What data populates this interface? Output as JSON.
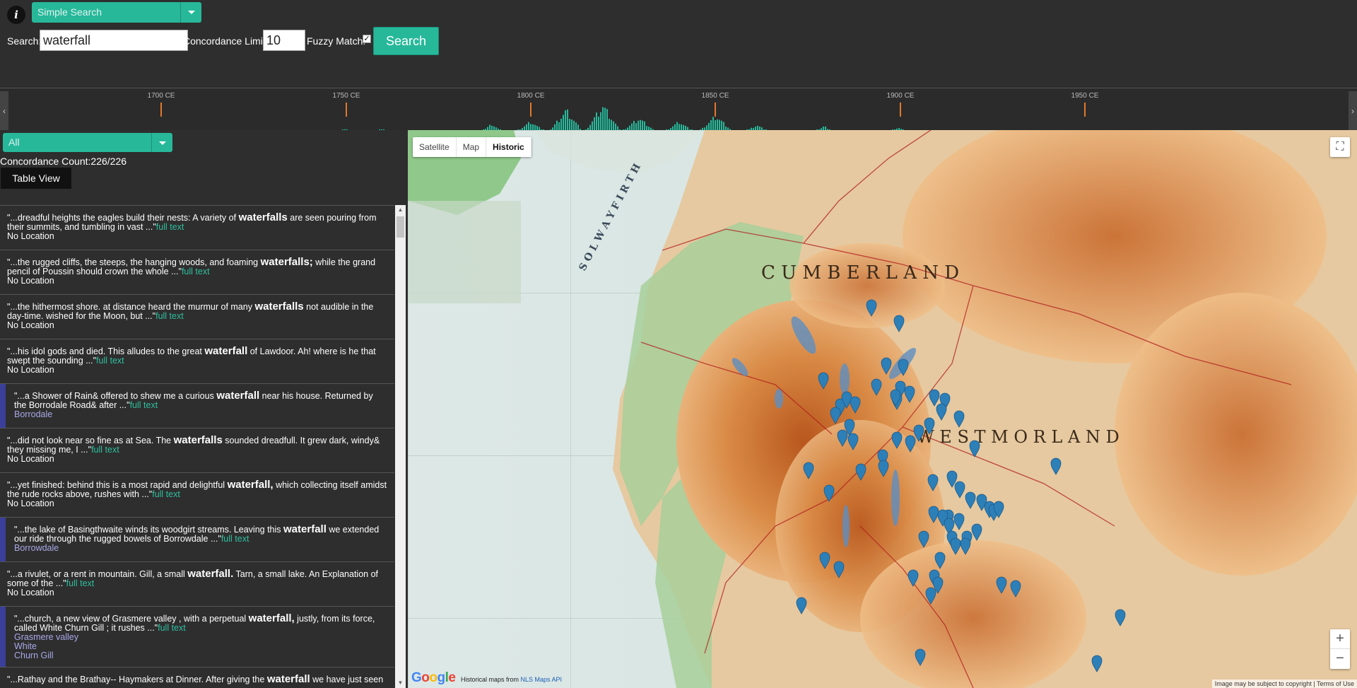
{
  "header": {
    "info_icon_glyph": "i",
    "search_mode": "Simple Search",
    "search_label": "Search:",
    "search_value": "waterfall",
    "limit_label": "Concordance Limit:",
    "limit_value": "10",
    "fuzzy_label": "Fuzzy Match:",
    "fuzzy_checked": true,
    "search_button": "Search"
  },
  "timeline": {
    "ticks": [
      "1700 CE",
      "1750 CE",
      "1800 CE",
      "1850 CE",
      "1900 CE",
      "1950 CE"
    ],
    "left_arrow": "‹",
    "right_arrow": "›",
    "accent_color": "#e07a2c",
    "bar_color": "#27b89a"
  },
  "left_panel": {
    "filter": "All",
    "concordance_count": "Concordance Count:226/226",
    "table_view_button": "Table View",
    "results": [
      {
        "pre": "\"...dreadful heights the eagles build their nests: A variety of ",
        "kw": "waterfalls",
        "post": " are seen pouring from their summits, and tumbling in vast ...\"",
        "link": "full text",
        "places": [
          "No Location"
        ],
        "has_location": false
      },
      {
        "pre": "\"...the rugged cliffs, the steeps, the hanging woods, and foaming ",
        "kw": "waterfalls;",
        "post": " while the grand pencil of Poussin should crown the whole ...\"",
        "link": "full text",
        "places": [
          "No Location"
        ],
        "has_location": false
      },
      {
        "pre": "\"...the hithermost shore. at distance heard the murmur of many ",
        "kw": "waterfalls",
        "post": " not audible in the day-time. wished for the Moon, but ...\"",
        "link": "full text",
        "places": [
          "No Location"
        ],
        "has_location": false
      },
      {
        "pre": "\"...his idol gods and died. This alludes to the great ",
        "kw": "waterfall",
        "post": " of Lawdoor. Ah! where is he that swept the sounding ...\"",
        "link": "full text",
        "places": [
          "No Location"
        ],
        "has_location": false
      },
      {
        "pre": "\"...a Shower of Rain& offered to shew me a curious ",
        "kw": "waterfall",
        "post": " near his house. Returned by the Borrodale Road& after ...\"",
        "link": "full text",
        "places": [
          "Borrodale"
        ],
        "has_location": true
      },
      {
        "pre": "\"...did not look near so fine as at Sea. The ",
        "kw": "waterfalls",
        "post": " sounded dreadfull. It grew dark, windy& they missing me, I ...\"",
        "link": "full text",
        "places": [
          "No Location"
        ],
        "has_location": false
      },
      {
        "pre": "\"...yet finished: behind this is a most rapid and delightful ",
        "kw": "waterfall,",
        "post": " which collecting itself amidst the rude rocks above, rushes with ...\"",
        "link": "full text",
        "places": [
          "No Location"
        ],
        "has_location": false
      },
      {
        "pre": "\"...the lake of Basingthwaite winds its woodgirt streams. Leaving this ",
        "kw": "waterfall",
        "post": " we extended our ride through the rugged bowels of Borrowdale ...\"",
        "link": "full text",
        "places": [
          "Borrowdale"
        ],
        "has_location": true
      },
      {
        "pre": "\"...a rivulet, or a rent in mountain. Gill, a small ",
        "kw": "waterfall.",
        "post": " Tarn, a small lake. An Explanation of some of the ...\"",
        "link": "full text",
        "places": [
          "No Location"
        ],
        "has_location": false
      },
      {
        "pre": "\"...church, a new view of Grasmere valley , with a perpetual ",
        "kw": "waterfall,",
        "post": " justly, from its force, called White Churn Gill ; it rushes ...\"",
        "link": "full text",
        "places": [
          "Grasmere valley",
          "White",
          "Churn Gill"
        ],
        "has_location": true
      },
      {
        "pre": "\"...Rathay and the Brathay-- Haymakers at Dinner. After giving the ",
        "kw": "waterfall",
        "post": " we have just seen",
        "link": "",
        "places": [],
        "has_location": false
      }
    ]
  },
  "map": {
    "type_buttons": [
      "Satellite",
      "Map",
      "Historic"
    ],
    "selected_type": "Historic",
    "fullscreen_icon": "⛶",
    "zoom_in": "+",
    "zoom_out": "−",
    "google_letters": [
      "G",
      "o",
      "o",
      "g",
      "l",
      "e"
    ],
    "attribution_prefix": "Historical maps from ",
    "attribution_link": "NLS Maps API",
    "terms": "Image may be subject to copyright  |  Terms of Use",
    "labels": [
      "C U M B E R L A N D",
      "W E S T M O R L A N D",
      "S O L W A Y   F I R T H"
    ],
    "marker_color": "#2d7fb8",
    "marker_count": 64
  }
}
